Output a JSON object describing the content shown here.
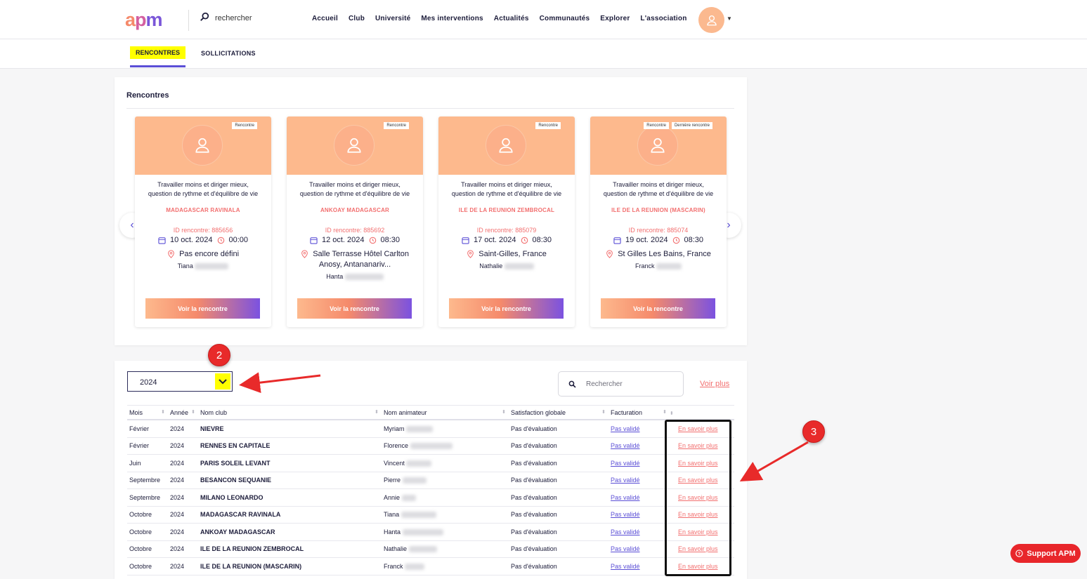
{
  "header": {
    "logo_text": "apm",
    "search_placeholder": "rechercher",
    "nav": [
      "Accueil",
      "Club",
      "Université",
      "Mes interventions",
      "Actualités",
      "Communautés",
      "Explorer",
      "L'association"
    ]
  },
  "subtabs": {
    "active": "RENCONTRES",
    "other": "SOLLICITATIONS"
  },
  "rencontres": {
    "title": "Rencontres",
    "cards": [
      {
        "badges": [
          "Rencontre"
        ],
        "title": "Travailler moins et diriger mieux, question de rythme et d'équilibre de vie",
        "club": "MADAGASCAR RAVINALA",
        "id": "ID rencontre: 885656",
        "date": "10 oct. 2024",
        "time": "00:00",
        "place": "Pas encore défini",
        "person": "Tiana",
        "button": "Voir la rencontre"
      },
      {
        "badges": [
          "Rencontre"
        ],
        "title": "Travailler moins et diriger mieux, question de rythme et d'équilibre de vie",
        "club": "ANKOAY MADAGASCAR",
        "id": "ID rencontre: 885692",
        "date": "12 oct. 2024",
        "time": "08:30",
        "place": "Salle Terrasse Hôtel Carlton Anosy, Antananariv...",
        "person": "Hanta",
        "button": "Voir la rencontre"
      },
      {
        "badges": [
          "Rencontre"
        ],
        "title": "Travailler moins et diriger mieux, question de rythme et d'équilibre de vie",
        "club": "ILE DE LA REUNION ZEMBROCAL",
        "id": "ID rencontre: 885079",
        "date": "17 oct. 2024",
        "time": "08:30",
        "place": "Saint-Gilles, France",
        "person": "Nathalie",
        "button": "Voir la rencontre"
      },
      {
        "badges": [
          "Rencontre",
          "Dernière rencontre"
        ],
        "title": "Travailler moins et diriger mieux, question de rythme et d'équilibre de vie",
        "club": "ILE DE LA REUNION (MASCARIN)",
        "id": "ID rencontre: 885074",
        "date": "19 oct. 2024",
        "time": "08:30",
        "place": "St Gilles Les Bains, France",
        "person": "Franck",
        "button": "Voir la rencontre"
      }
    ]
  },
  "filters": {
    "year": "2024",
    "search_placeholder": "Rechercher",
    "voir_plus": "Voir plus"
  },
  "table": {
    "headers": [
      "Mois",
      "Année",
      "Nom club",
      "Nom animateur",
      "Satisfaction globale",
      "Facturation"
    ],
    "rows": [
      {
        "mois": "Février",
        "annee": "2024",
        "club": "NIEVRE",
        "animateur": "Myriam",
        "satisfaction": "Pas d'évaluation",
        "facturation": "Pas validé",
        "action": "En savoir plus"
      },
      {
        "mois": "Février",
        "annee": "2024",
        "club": "RENNES EN CAPITALE",
        "animateur": "Florence",
        "satisfaction": "Pas d'évaluation",
        "facturation": "Pas validé",
        "action": "En savoir plus"
      },
      {
        "mois": "Juin",
        "annee": "2024",
        "club": "PARIS SOLEIL LEVANT",
        "animateur": "Vincent",
        "satisfaction": "Pas d'évaluation",
        "facturation": "Pas validé",
        "action": "En savoir plus"
      },
      {
        "mois": "Septembre",
        "annee": "2024",
        "club": "BESANCON SEQUANIE",
        "animateur": "Pierre",
        "satisfaction": "Pas d'évaluation",
        "facturation": "Pas validé",
        "action": "En savoir plus"
      },
      {
        "mois": "Septembre",
        "annee": "2024",
        "club": "MILANO LEONARDO",
        "animateur": "Annie",
        "satisfaction": "Pas d'évaluation",
        "facturation": "Pas validé",
        "action": "En savoir plus"
      },
      {
        "mois": "Octobre",
        "annee": "2024",
        "club": "MADAGASCAR RAVINALA",
        "animateur": "Tiana",
        "satisfaction": "Pas d'évaluation",
        "facturation": "Pas validé",
        "action": "En savoir plus"
      },
      {
        "mois": "Octobre",
        "annee": "2024",
        "club": "ANKOAY MADAGASCAR",
        "animateur": "Hanta",
        "satisfaction": "Pas d'évaluation",
        "facturation": "Pas validé",
        "action": "En savoir plus"
      },
      {
        "mois": "Octobre",
        "annee": "2024",
        "club": "ILE DE LA REUNION ZEMBROCAL",
        "animateur": "Nathalie",
        "satisfaction": "Pas d'évaluation",
        "facturation": "Pas validé",
        "action": "En savoir plus"
      },
      {
        "mois": "Octobre",
        "annee": "2024",
        "club": "ILE DE LA REUNION (MASCARIN)",
        "animateur": "Franck",
        "satisfaction": "Pas d'évaluation",
        "facturation": "Pas validé",
        "action": "En savoir plus"
      }
    ]
  },
  "annotations": {
    "step2": "2",
    "step3": "3"
  },
  "support": {
    "label": "Support APM"
  },
  "colors": {
    "accent": "#5b4fd6",
    "coral": "#f26f6f",
    "peach": "#fdb98d",
    "highlight": "#ffff00",
    "annotation": "#e82a2a"
  }
}
